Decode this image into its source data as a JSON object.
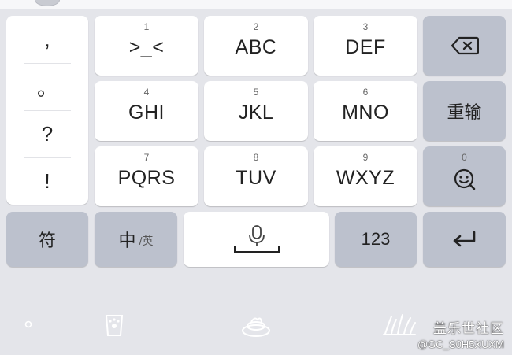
{
  "punctuation": [
    ",",
    "。",
    "?",
    "!"
  ],
  "keys": {
    "k1": {
      "num": "1",
      "label": ">_<"
    },
    "k2": {
      "num": "2",
      "label": "ABC"
    },
    "k3": {
      "num": "3",
      "label": "DEF"
    },
    "k4": {
      "num": "4",
      "label": "GHI"
    },
    "k5": {
      "num": "5",
      "label": "JKL"
    },
    "k6": {
      "num": "6",
      "label": "MNO"
    },
    "k7": {
      "num": "7",
      "label": "PQRS"
    },
    "k8": {
      "num": "8",
      "label": "TUV"
    },
    "k9": {
      "num": "9",
      "label": "WXYZ"
    }
  },
  "side": {
    "delete_icon": "backspace-icon",
    "reenter_label": "重输",
    "emoji_num": "0",
    "emoji_icon": "emoji-search-icon"
  },
  "bottom_row": {
    "symbols_label": "符",
    "lang_main": "中",
    "lang_sub": "/英",
    "space_icon": "microphone-icon",
    "numbers_label": "123",
    "enter_icon": "enter-icon"
  },
  "toolbar_icons": [
    "dot-icon",
    "paw-cup-icon",
    "cake-icon",
    "grass-icon"
  ],
  "watermark": {
    "line1": "盖乐世社区",
    "line2": "@GC_S0H5XUXM"
  }
}
